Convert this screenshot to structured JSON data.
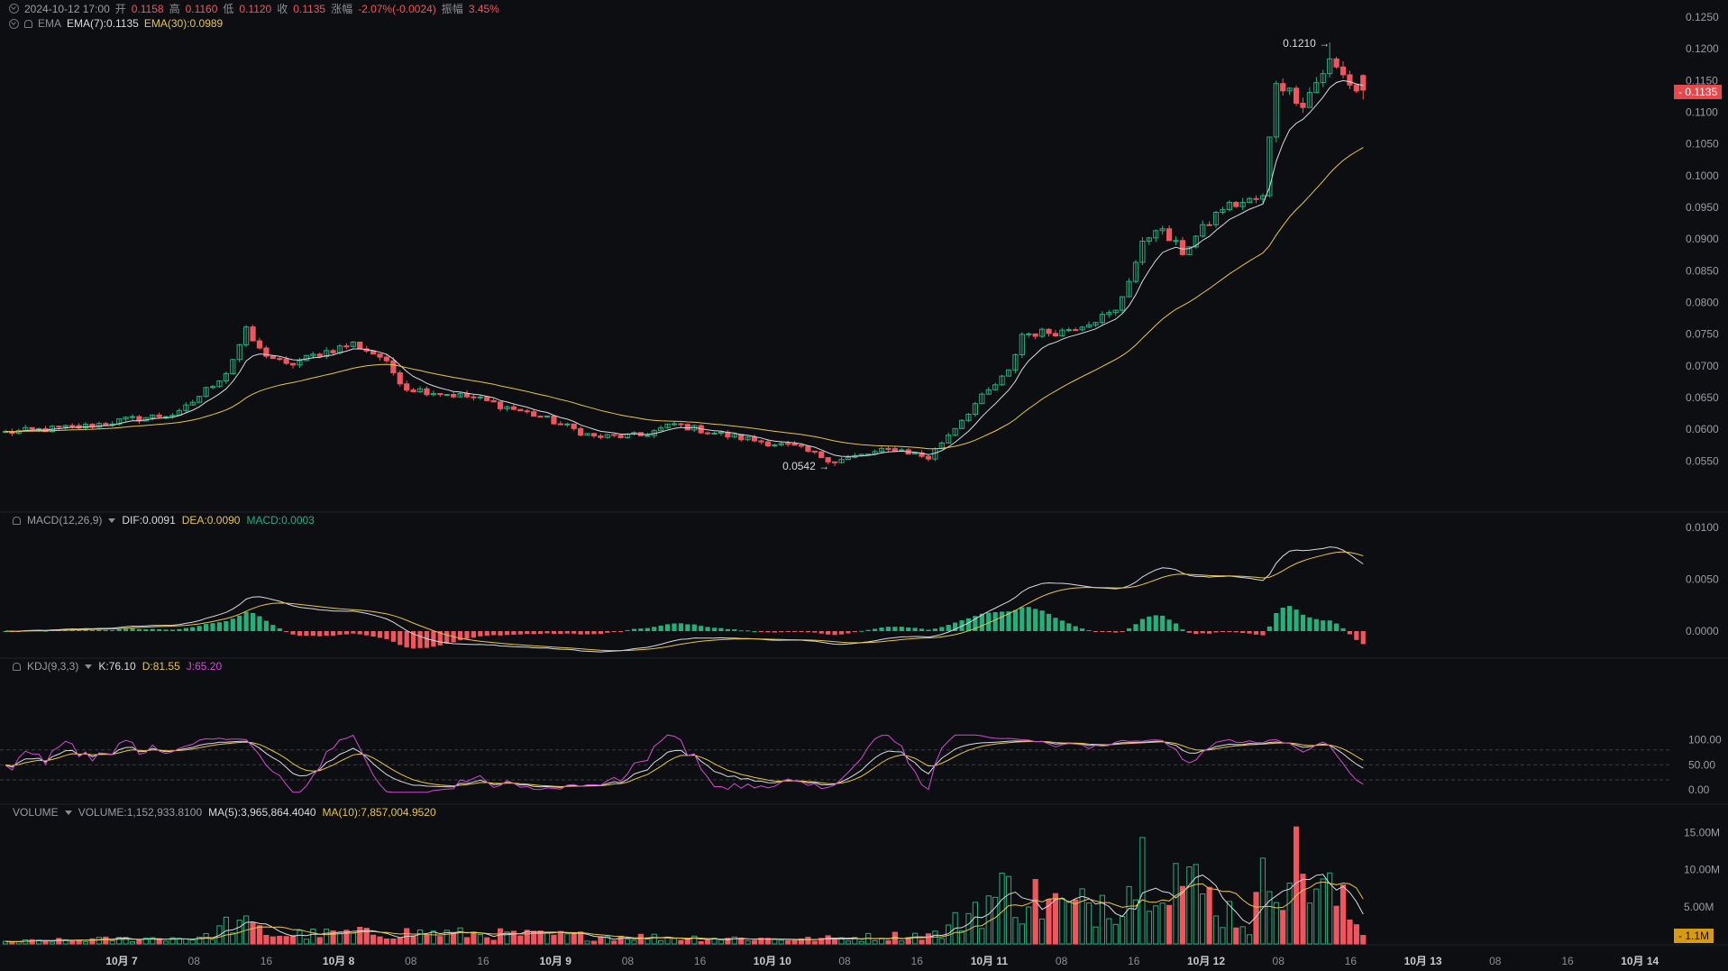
{
  "ohlc_header": {
    "datetime": "2024-10-12 17:00",
    "open_label": "开",
    "open": "0.1158",
    "high_label": "高",
    "high": "0.1160",
    "low_label": "低",
    "low": "0.1120",
    "close_label": "收",
    "close": "0.1135",
    "change_label": "涨幅",
    "change": "-2.07%(-0.0024)",
    "amplitude_label": "振幅",
    "amplitude": "3.45%"
  },
  "ema_header": {
    "name": "EMA",
    "ema7": "EMA(7):0.1135",
    "ema30": "EMA(30):0.0989"
  },
  "macd_header": {
    "name": "MACD(12,26,9)",
    "dif": "DIF:0.0091",
    "dea": "DEA:0.0090",
    "macd": "MACD:0.0003"
  },
  "kdj_header": {
    "name": "KDJ(9,3,3)",
    "k": "K:76.10",
    "d": "D:81.55",
    "j": "J:65.20"
  },
  "volume_header": {
    "name": "VOLUME",
    "volume": "VOLUME:1,152,933.8100",
    "ma5": "MA(5):3,965,864.4040",
    "ma10": "MA(10):7,857,004.9520"
  },
  "price_badge": "0.1135",
  "volume_badge": "1.1M",
  "colors": {
    "up": "#22b07d",
    "down": "#f0555e",
    "ema7": "#d8dadd",
    "ema30": "#e8c547",
    "j": "#d44ad6",
    "bg": "#0d0e11"
  },
  "chart_data": {
    "type": "candlestick",
    "price_axis": {
      "ticks": [
        "0.1250",
        "0.1200",
        "0.1150",
        "0.1100",
        "0.1050",
        "0.1000",
        "0.0950",
        "0.0900",
        "0.0850",
        "0.0800",
        "0.0750",
        "0.0700",
        "0.0650",
        "0.0600",
        "0.0550"
      ],
      "range": [
        0.0515,
        0.126
      ]
    },
    "annotations": {
      "high": {
        "label": "0.1210",
        "value": 0.121
      },
      "low": {
        "label": "0.0542",
        "value": 0.0542
      }
    },
    "macd_axis": {
      "ticks": [
        "0.0100",
        "0.0050",
        "0.0000"
      ]
    },
    "kdj_axis": {
      "ticks": [
        "100.00",
        "50.00",
        "0.00"
      ],
      "dashed_levels": [
        80,
        50,
        20
      ]
    },
    "volume_axis": {
      "ticks": [
        "15.00M",
        "10.00M",
        "5.00M"
      ]
    },
    "time_axis": {
      "labels": [
        "10月 7",
        "08",
        "16",
        "10月 8",
        "08",
        "16",
        "10月 9",
        "08",
        "16",
        "10月 10",
        "08",
        "16",
        "10月 11",
        "08",
        "16",
        "10月 12",
        "08",
        "16",
        "10月 13",
        "08",
        "16",
        "10月 14"
      ],
      "bold": [
        "10月 7",
        "10月 8",
        "10月 9",
        "10月 10",
        "10月 11",
        "10月 12",
        "10月 13",
        "10月 14"
      ]
    },
    "anchors": [
      [
        0,
        0.0595
      ],
      [
        12,
        0.0605
      ],
      [
        18,
        0.0615
      ],
      [
        26,
        0.0625
      ],
      [
        33,
        0.069
      ],
      [
        36,
        0.0755
      ],
      [
        38,
        0.0725
      ],
      [
        42,
        0.07
      ],
      [
        47,
        0.072
      ],
      [
        52,
        0.0735
      ],
      [
        56,
        0.0715
      ],
      [
        60,
        0.0665
      ],
      [
        70,
        0.065
      ],
      [
        80,
        0.062
      ],
      [
        88,
        0.0588
      ],
      [
        95,
        0.059
      ],
      [
        100,
        0.0608
      ],
      [
        108,
        0.059
      ],
      [
        118,
        0.0572
      ],
      [
        124,
        0.055
      ],
      [
        133,
        0.057
      ],
      [
        138,
        0.0555
      ],
      [
        140,
        0.058
      ],
      [
        145,
        0.064
      ],
      [
        150,
        0.069
      ],
      [
        152,
        0.075
      ],
      [
        158,
        0.0755
      ],
      [
        166,
        0.0785
      ],
      [
        170,
        0.089
      ],
      [
        172,
        0.092
      ],
      [
        176,
        0.088
      ],
      [
        182,
        0.095
      ],
      [
        188,
        0.0965
      ],
      [
        190,
        0.115
      ],
      [
        194,
        0.1115
      ],
      [
        198,
        0.118
      ],
      [
        202,
        0.1135
      ]
    ],
    "volume_anchors": [
      [
        0,
        0.3
      ],
      [
        30,
        0.9
      ],
      [
        34,
        3.0
      ],
      [
        40,
        1.2
      ],
      [
        60,
        1.5
      ],
      [
        90,
        1.0
      ],
      [
        120,
        0.6
      ],
      [
        140,
        1.3
      ],
      [
        145,
        5.0
      ],
      [
        150,
        7.0
      ],
      [
        160,
        4.5
      ],
      [
        168,
        8.0
      ],
      [
        172,
        14.0
      ],
      [
        176,
        8.5
      ],
      [
        182,
        5.0
      ],
      [
        186,
        2.5
      ],
      [
        190,
        12.5
      ],
      [
        195,
        9.0
      ],
      [
        200,
        5.0
      ],
      [
        203,
        1.15
      ]
    ],
    "last_volume": 1.15
  }
}
